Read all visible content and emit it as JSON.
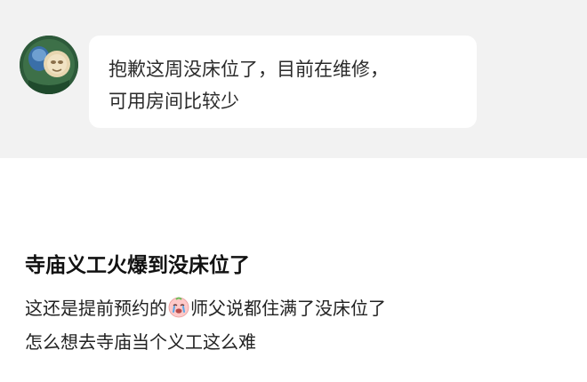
{
  "chat": {
    "message_lines": [
      "抱歉这周没床位了，目前在维修，",
      "可用房间比较少"
    ]
  },
  "post": {
    "title": "寺庙义工火爆到没床位了",
    "line1_before_emoji": "这还是提前预约的",
    "emoji": "crying-face-emoji",
    "line1_after_emoji": "师父说都住满了没床位了",
    "line2": "怎么想去寺庙当个义工这么难"
  },
  "colors": {
    "chat_background": "#f2f2f2",
    "bubble_background": "#ffffff",
    "text": "#222222"
  }
}
